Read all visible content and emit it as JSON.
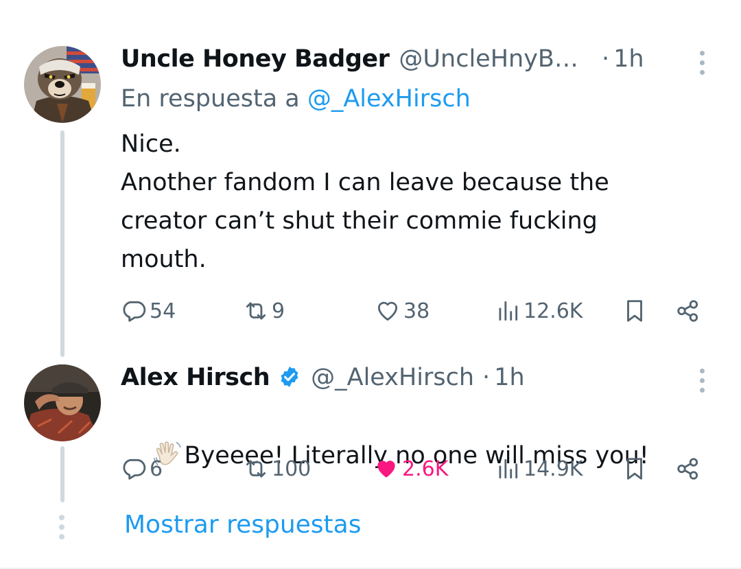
{
  "tweets": [
    {
      "name": "Uncle Honey Badger",
      "handle": "@UncleHnyB…",
      "dot": "·",
      "time": "1h",
      "reply_prefix": "En respuesta a ",
      "reply_to": "@_AlexHirsch",
      "text": "Nice.\nAnother fandom I can leave because the creator can’t shut their commie fucking mouth.",
      "avatar_icon": "honey-badger-avatar",
      "actions": {
        "replies": "54",
        "reposts": "9",
        "likes": "38",
        "views": "12.6K"
      },
      "liked": false
    },
    {
      "name": "Alex Hirsch",
      "handle": "@_AlexHirsch",
      "dot": "·",
      "time": "1h",
      "verified": true,
      "emoji": "waving-hand-emoji",
      "text": "Byeeee! Literally no one will miss you!",
      "avatar_icon": "alex-hirsch-avatar",
      "actions": {
        "replies": "6",
        "reposts": "100",
        "likes": "2.6K",
        "views": "14.9K"
      },
      "liked": true
    }
  ],
  "show_replies": "Mostrar respuestas",
  "colors": {
    "accent": "#1d9bf0",
    "like": "#f91880",
    "secondary_text": "#536471",
    "thread_line": "#cfd9de"
  }
}
